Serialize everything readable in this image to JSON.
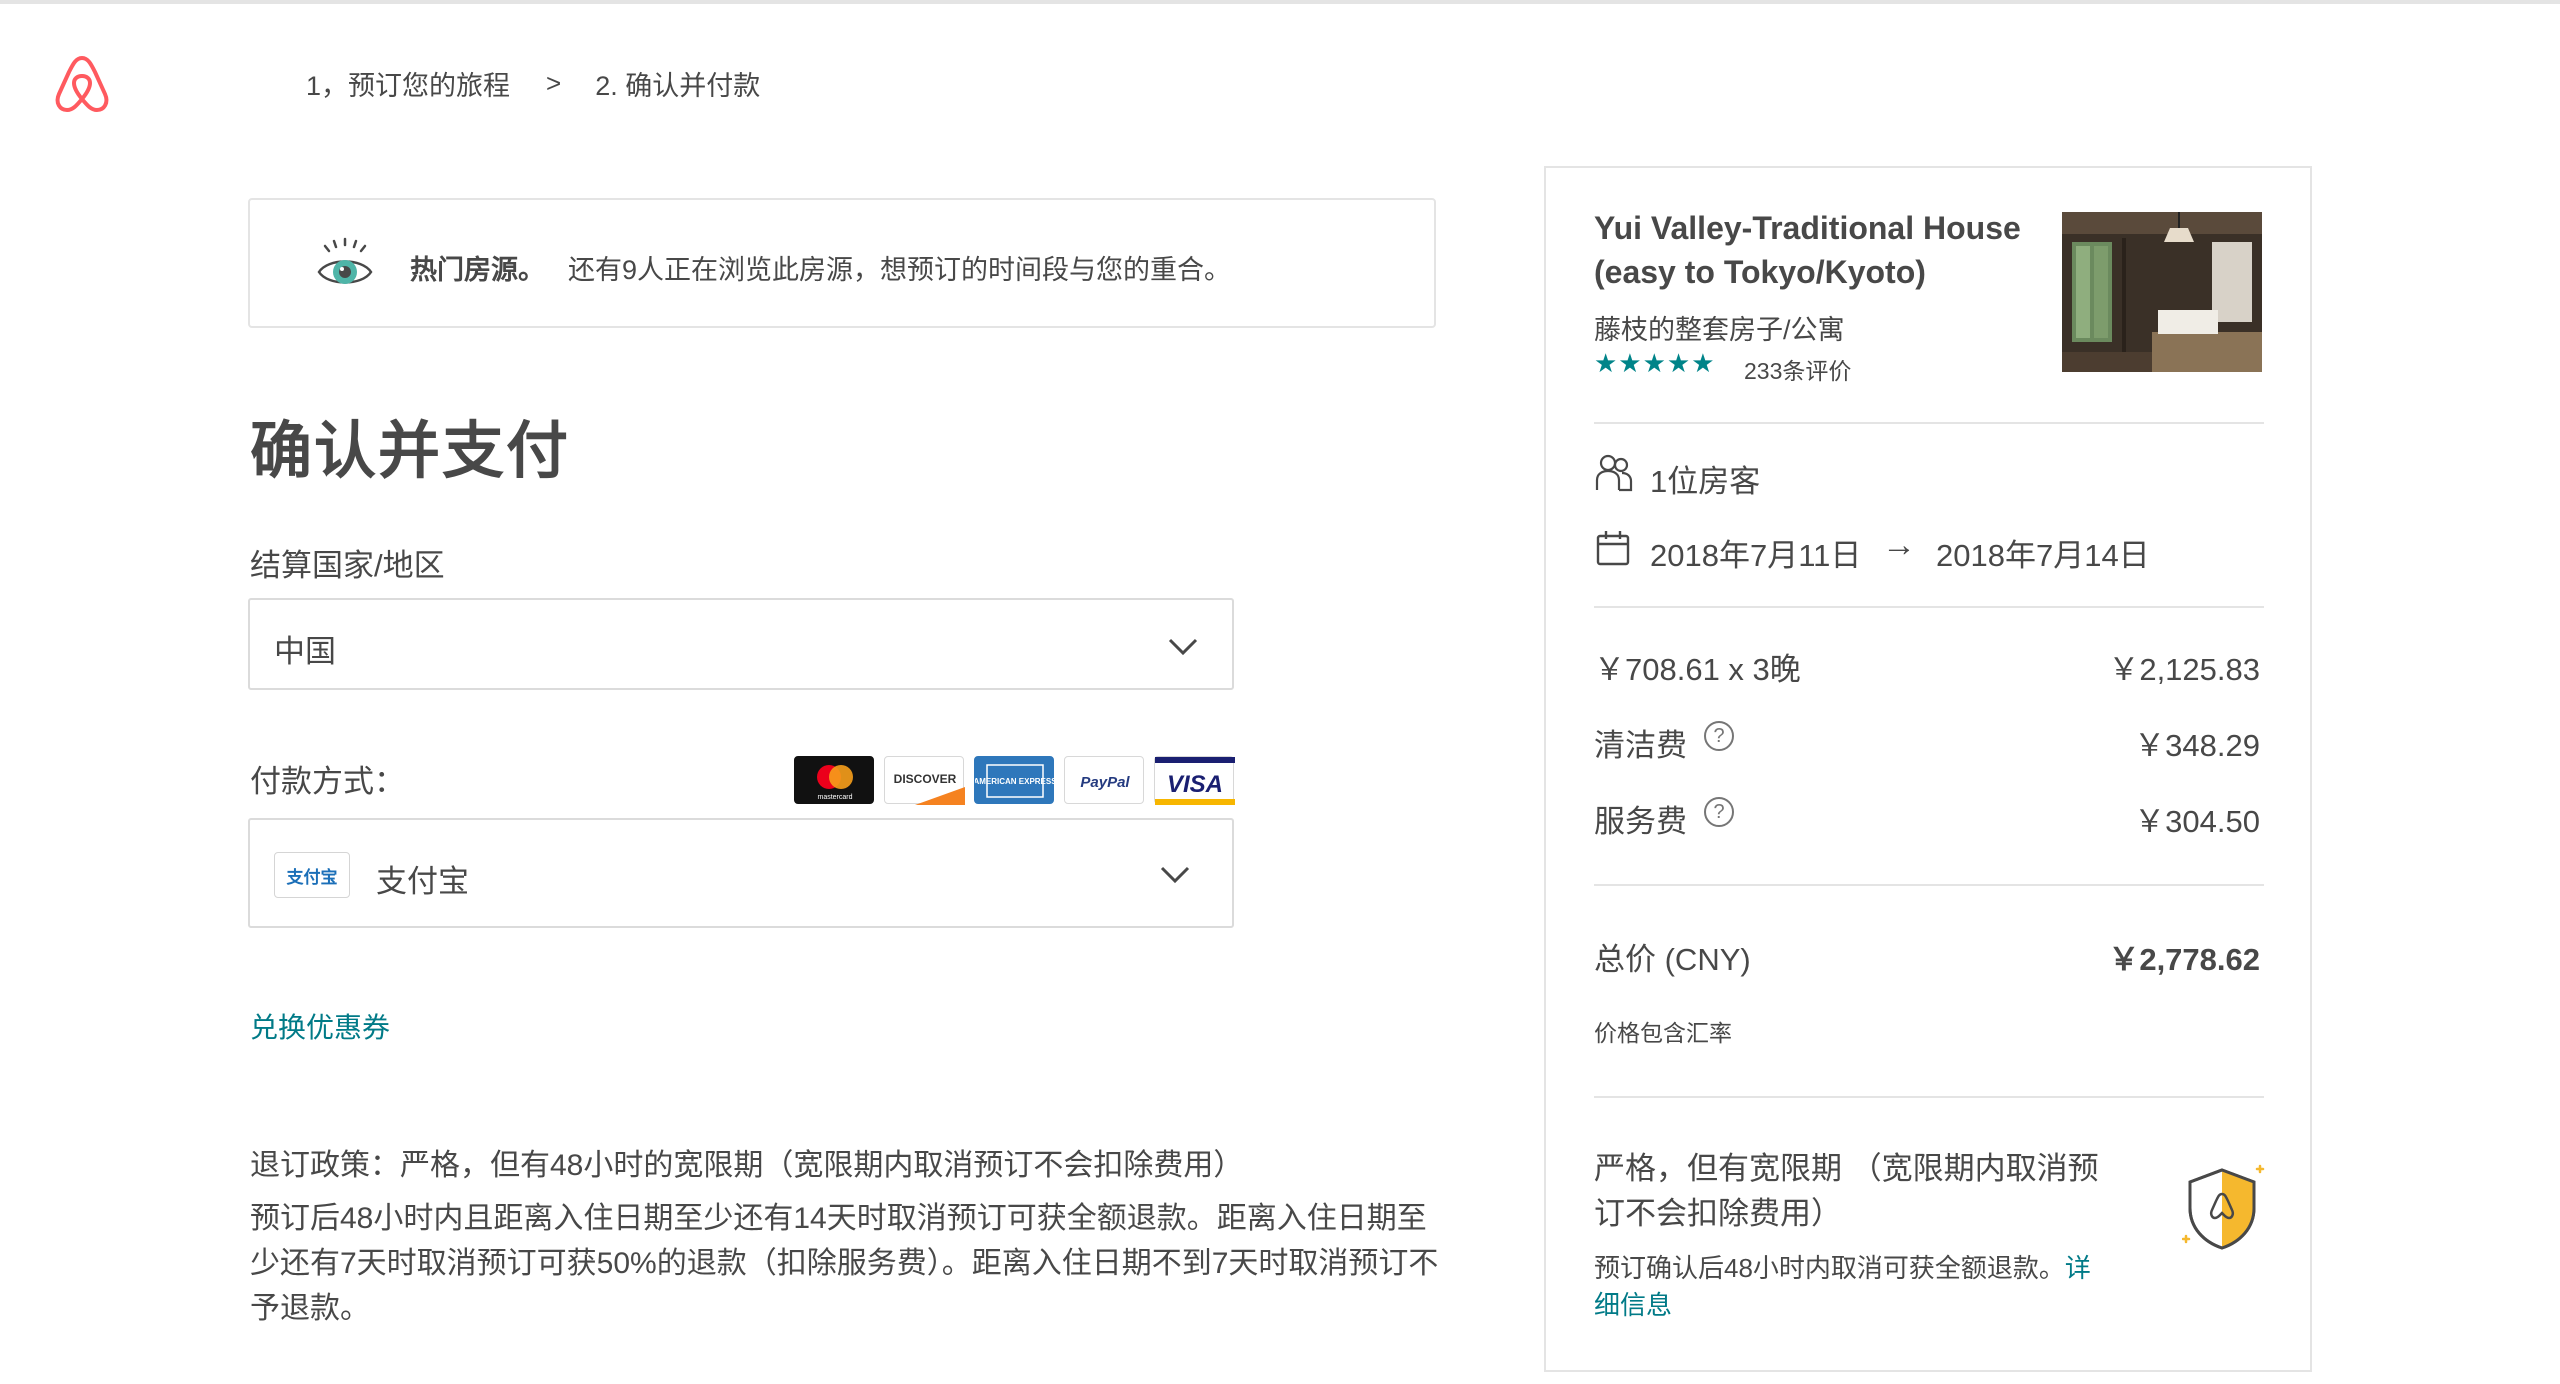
{
  "breadcrumb": {
    "step1": "1，预订您的旅程",
    "separator": ">",
    "step2": "2. 确认并付款"
  },
  "hot_notice": {
    "title": "热门房源。",
    "text": "还有9人正在浏览此房源，想预订的时间段与您的重合。",
    "icon": "eye-icon"
  },
  "page_title": "确认并支付",
  "billing_country": {
    "label": "结算国家/地区",
    "value": "中国"
  },
  "payment": {
    "label": "付款方式：",
    "cards": [
      "mastercard",
      "DISCOVER",
      "AMERICAN EXPRESS",
      "PayPal",
      "VISA"
    ],
    "selected_logo": "支付宝",
    "selected": "支付宝"
  },
  "coupon_link": "兑换优惠券",
  "policy": {
    "title": "退订政策：严格，但有48小时的宽限期（宽限期内取消预订不会扣除费用）",
    "body": "预订后48小时内且距离入住日期至少还有14天时取消预订可获全额退款。距离入住日期至少还有7天时取消预订可获50%的退款（扣除服务费）。距离入住日期不到7天时取消预订不予退款。"
  },
  "summary": {
    "listing_title": "Yui Valley-Traditional House (easy to Tokyo/Kyoto)",
    "listing_type": "藤枝的整套房子/公寓",
    "stars": "★★★★★",
    "rating": 5,
    "reviews": "233条评价",
    "guests": "1位房客",
    "checkin": "2018年7月11日",
    "arrow": "→",
    "checkout": "2018年7月14日",
    "nightly_label": "￥708.61 x 3晚",
    "nightly_total": "￥2,125.83",
    "cleaning_label": "清洁费",
    "cleaning_fee": "￥348.29",
    "service_label": "服务费",
    "service_fee": "￥304.50",
    "help_glyph": "?",
    "total_label": "总价 (CNY)",
    "total": "￥2,778.62",
    "fx_note": "价格包含汇率",
    "cancel_title": "严格，但有宽限期 （宽限期内取消预订不会扣除费用）",
    "cancel_body": "预订确认后48小时内取消可获全额退款。",
    "detail_link": "详细信息"
  },
  "colors": {
    "brand": "#FF5A5F",
    "teal": "#008489",
    "text": "#484848",
    "shield_yellow": "#F5B82E"
  }
}
